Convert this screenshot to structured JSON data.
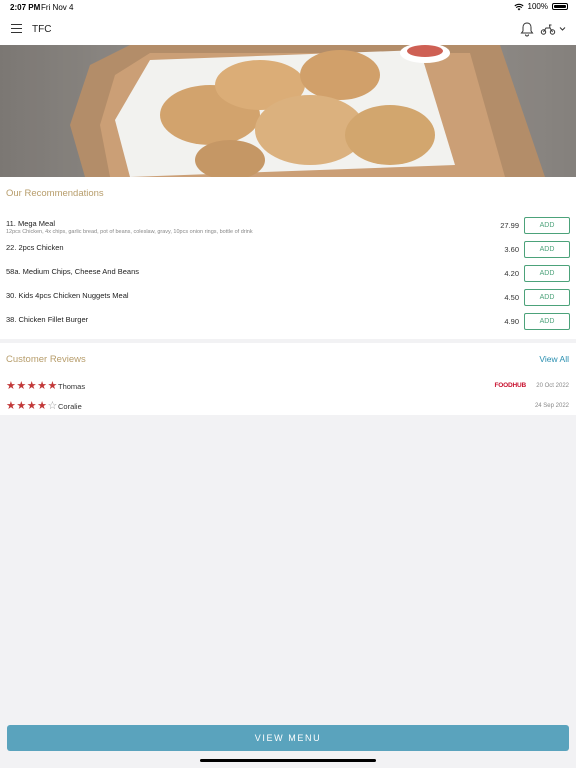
{
  "status_bar": {
    "time": "2:07 PM",
    "date": "Fri Nov 4",
    "battery": "100%"
  },
  "header": {
    "title": "TFC"
  },
  "recommendations": {
    "title": "Our Recommendations",
    "items": [
      {
        "name": "11. Mega Meal",
        "description": "12pcs Chicken, 4x chips, garlic bread, pot of beans, coleslaw, gravy, 10pcs onion rings, bottle of drink",
        "price": "27.99",
        "button": "ADD"
      },
      {
        "name": "22. 2pcs Chicken",
        "description": "",
        "price": "3.60",
        "button": "ADD"
      },
      {
        "name": "58a. Medium Chips, Cheese And Beans",
        "description": "",
        "price": "4.20",
        "button": "ADD"
      },
      {
        "name": "30. Kids 4pcs Chicken Nuggets Meal",
        "description": "",
        "price": "4.50",
        "button": "ADD"
      },
      {
        "name": "38. Chicken Fillet Burger",
        "description": "",
        "price": "4.90",
        "button": "ADD"
      }
    ]
  },
  "reviews": {
    "title": "Customer Reviews",
    "view_all": "View All",
    "items": [
      {
        "name": "Thomas",
        "rating": 5,
        "source": "FOODHUB",
        "date": "20 Oct 2022"
      },
      {
        "name": "Coralie",
        "rating": 4,
        "source": "",
        "date": "24 Sep 2022"
      }
    ]
  },
  "footer": {
    "view_menu": "VIEW MENU"
  },
  "colors": {
    "accent_button": "#5aa3bd",
    "add_green": "#4ca27a",
    "star_red": "#c23838",
    "section_gold": "#b79d6b",
    "link_blue": "#2a8fb0",
    "foodhub_red": "#c8102e"
  }
}
